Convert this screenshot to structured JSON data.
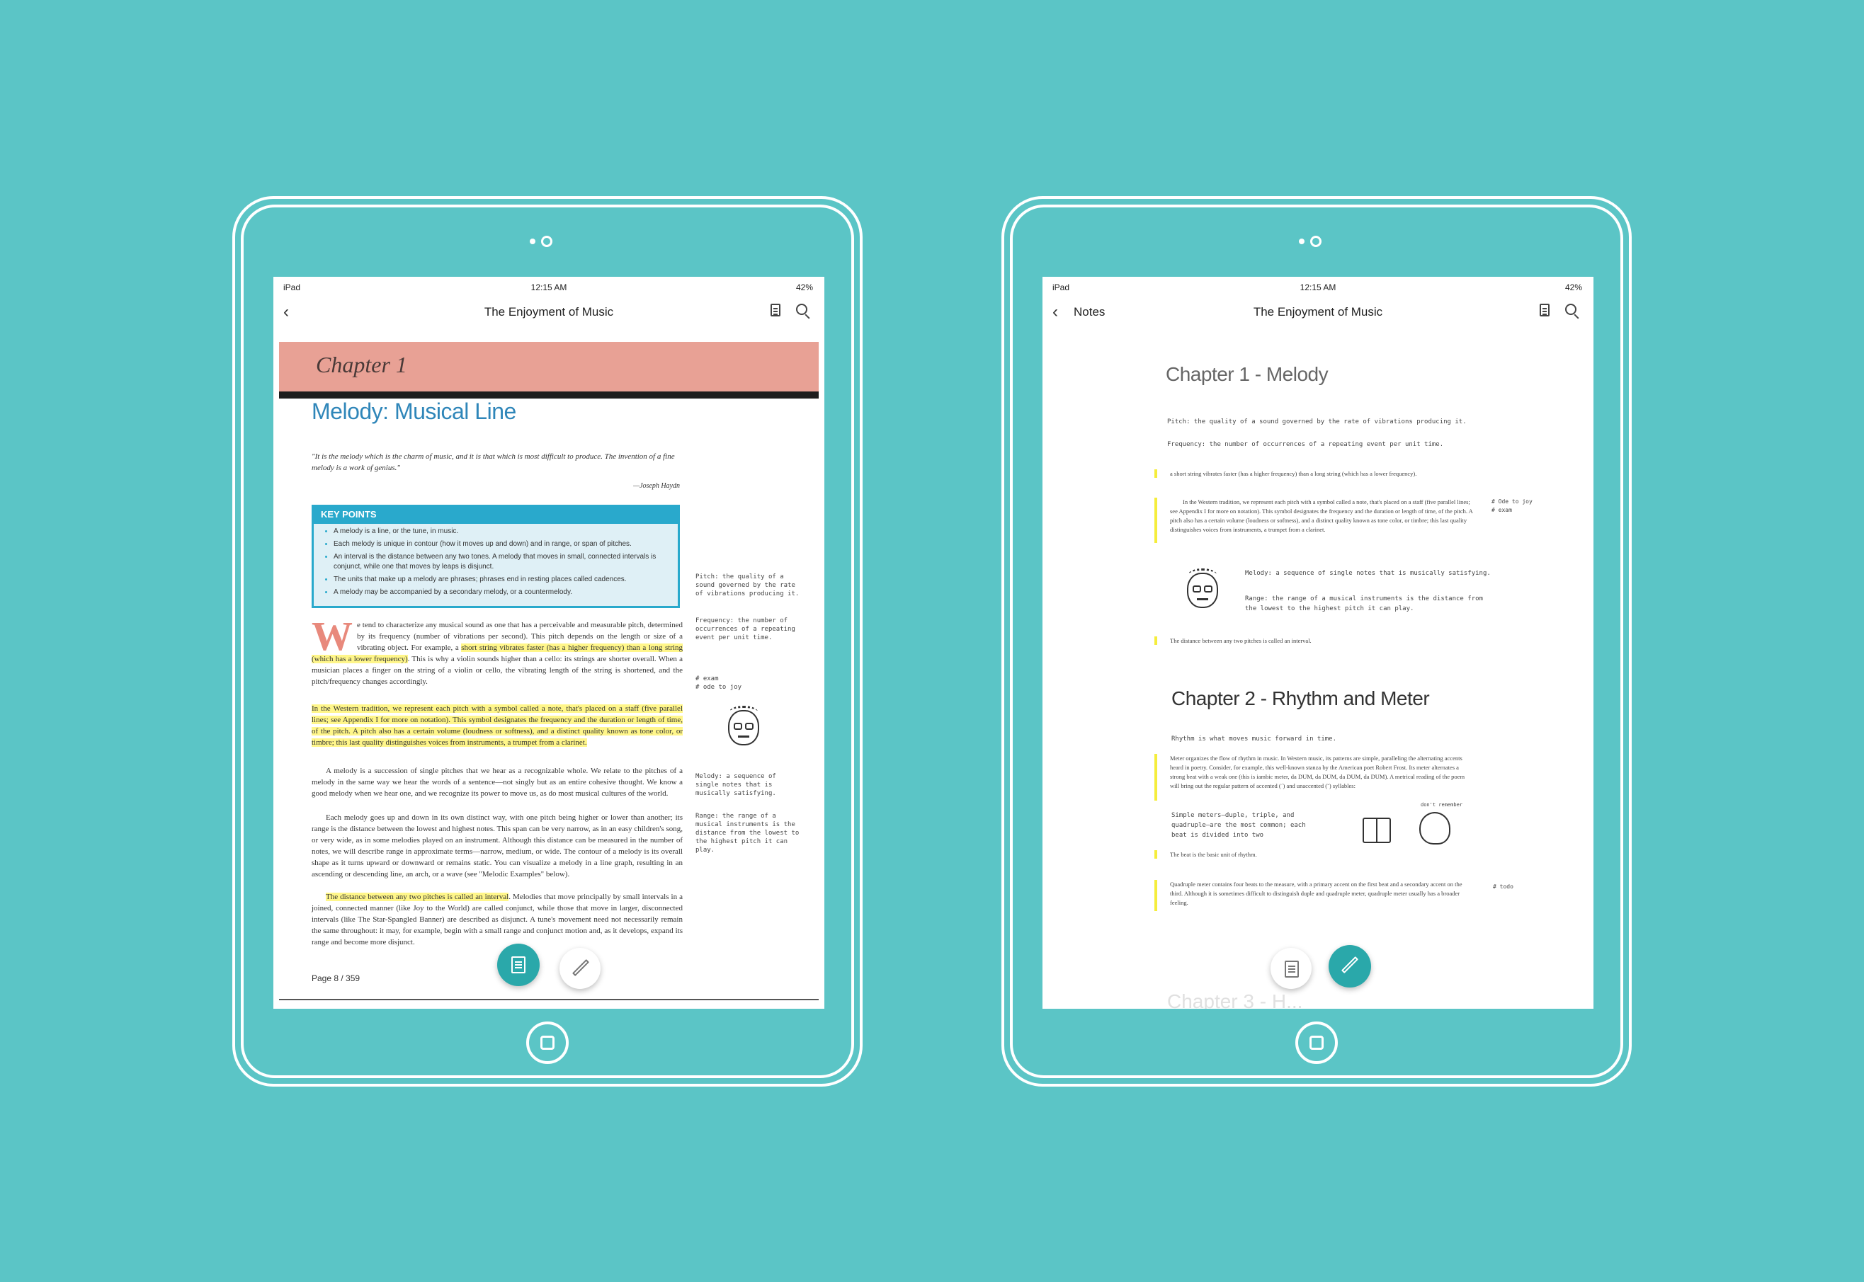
{
  "status_bar": {
    "carrier": "iPad",
    "time": "12:15 AM",
    "battery": "42%"
  },
  "left_screen": {
    "nav_title": "The Enjoyment of Music",
    "chapter_label": "Chapter 1",
    "title": "Melody: Musical Line",
    "epigraph": "\"It is the melody which is the charm of music, and it is that which is most difficult to produce. The invention of a fine melody is a work of genius.\"",
    "epigraph_author": "—Joseph Haydn",
    "key_points": {
      "heading": "KEY POINTS",
      "items": [
        "A melody is a line, or the tune, in music.",
        "Each melody is unique in contour (how it moves up and down) and in range, or span of pitches.",
        "An interval is the distance between any two tones. A melody that moves in small, connected intervals is conjunct, while one that moves by leaps is disjunct.",
        "The units that make up a melody are phrases; phrases end in resting places called cadences.",
        "A melody may be accompanied by a secondary melody, or a countermelody."
      ]
    },
    "para1_dropcap": "W",
    "para1_a": "e tend to characterize any musical sound as one that has a perceivable and measurable pitch, determined by its frequency (number of vibrations per second). This pitch depends on the length or size of a vibrating object. For example, a ",
    "para1_hl": "short string vibrates faster (has a higher frequency) than a long string (which has a lower frequency)",
    "para1_b": ". This is why a violin sounds higher than a cello: its strings are shorter overall. When a musician places a finger on the string of a violin or cello, the vibrating length of the string is shortened, and the pitch/frequency changes accordingly.",
    "para2": "In the Western tradition, we represent each pitch with a symbol called a note, that's placed on a staff (five parallel lines; see Appendix I for more on notation). This symbol designates the frequency and the duration or length of time, of the pitch. A pitch also has a certain volume (loudness or softness), and a distinct quality known as tone color, or timbre; this last quality distinguishes voices from instruments, a trumpet from a clarinet.",
    "para3": "A melody is a succession of single pitches that we hear as a recognizable whole. We relate to the pitches of a melody in the same way we hear the words of a sentence—not singly but as an entire cohesive thought. We know a good melody when we hear one, and we recognize its power to move us, as do most musical cultures of the world.",
    "para4": "Each melody goes up and down in its own distinct way, with one pitch being higher or lower than another; its range is the distance between the lowest and highest notes. This span can be very narrow, as in an easy children's song, or very wide, as in some melodies played on an instrument. Although this distance can be measured in the number of notes, we will describe range in approximate terms—narrow, medium, or wide. The contour of a melody is its overall shape as it turns upward or downward or remains static. You can visualize a melody in a line graph, resulting in an ascending or descending line, an arch, or a wave (see \"Melodic Examples\" below).",
    "para5_hl": "The distance between any two pitches is called an interval",
    "para5": ". Melodies that move principally by small intervals in a joined, connected manner (like Joy to the World) are called conjunct, while those that move in larger, disconnected intervals (like The Star-Spangled Banner) are described as disjunct. A tune's movement need not necessarily remain the same throughout: it may, for example, begin with a small range and conjunct motion and, as it develops, expand its range and become more disjunct.",
    "margin_notes": {
      "pitch": "Pitch: the quality of a sound governed by the rate of vibrations producing it.",
      "frequency": "Frequency: the number of occurrences of a repeating event per unit time.",
      "tags": "# exam\n# ode to joy",
      "melody": "Melody: a sequence of single notes that is musically satisfying.",
      "range": "Range: the range of a musical instruments is the distance from the lowest to the highest pitch it can play."
    },
    "page_indicator": "Page 8 / 359"
  },
  "right_screen": {
    "nav_title": "The Enjoyment of Music",
    "back_label": "Notes",
    "chapter1_heading": "Chapter 1 - Melody",
    "pitch_note": "Pitch: the quality of a sound governed by the rate of vibrations producing it.",
    "frequency_note": "Frequency: the number of occurrences of a repeating event per unit time.",
    "quote1": "a short string vibrates faster (has a higher frequency) than a long string (which has a lower frequency).",
    "quote2": "In the Western tradition, we represent each pitch with a symbol called a note, that's placed on a staff (five parallel lines; see Appendix I for more on notation). This symbol designates the frequency and the duration or length of time, of the pitch. A pitch also has a certain volume (loudness or softness), and a distinct quality known as tone color, or timbre; this last quality distinguishes voices from instruments, a trumpet from a clarinet.",
    "tags1": "# Ode to joy\n# exam",
    "melody_note": "Melody: a sequence of single notes that is musically satisfying.",
    "range_note": "Range: the range of a musical instruments is the distance from the lowest to the highest pitch it can play.",
    "quote3": "The distance between any two pitches is called an interval.",
    "chapter2_heading": "Chapter 2 - Rhythm and Meter",
    "rhythm_note": "Rhythm is what moves music forward in time.",
    "quote4": "Meter organizes the flow of rhythm in music. In Western music, its patterns are simple, paralleling the alternating accents heard in poetry. Consider, for example, this well-known stanza by the American poet Robert Frost. Its meter alternates a strong beat with a weak one (this is iambic meter, da DUM, da DUM, da DUM, da DUM). A metrical reading of the poem will bring out the regular pattern of accented (´) and unaccented (˘) syllables:",
    "meters_note": "Simple meters—duple, triple, and quadruple—are the most common; each beat is divided into two",
    "sketch_label": "don't remember",
    "quote5": "The beat is the basic unit of rhythm.",
    "quote6": "Quadruple meter contains four beats to the measure, with a primary accent on the first beat and a secondary accent on the third. Although it is sometimes difficult to distinguish duple and quadruple meter, quadruple meter usually has a broader feeling.",
    "tag2": "# todo",
    "faded_heading": "Chapter 3 - H..."
  },
  "colors": {
    "background": "#5bc5c6",
    "accent": "#2aa8aa",
    "chapter_banner": "#e8a195",
    "highlight": "#fff68a",
    "title_blue": "#2f86b9"
  }
}
